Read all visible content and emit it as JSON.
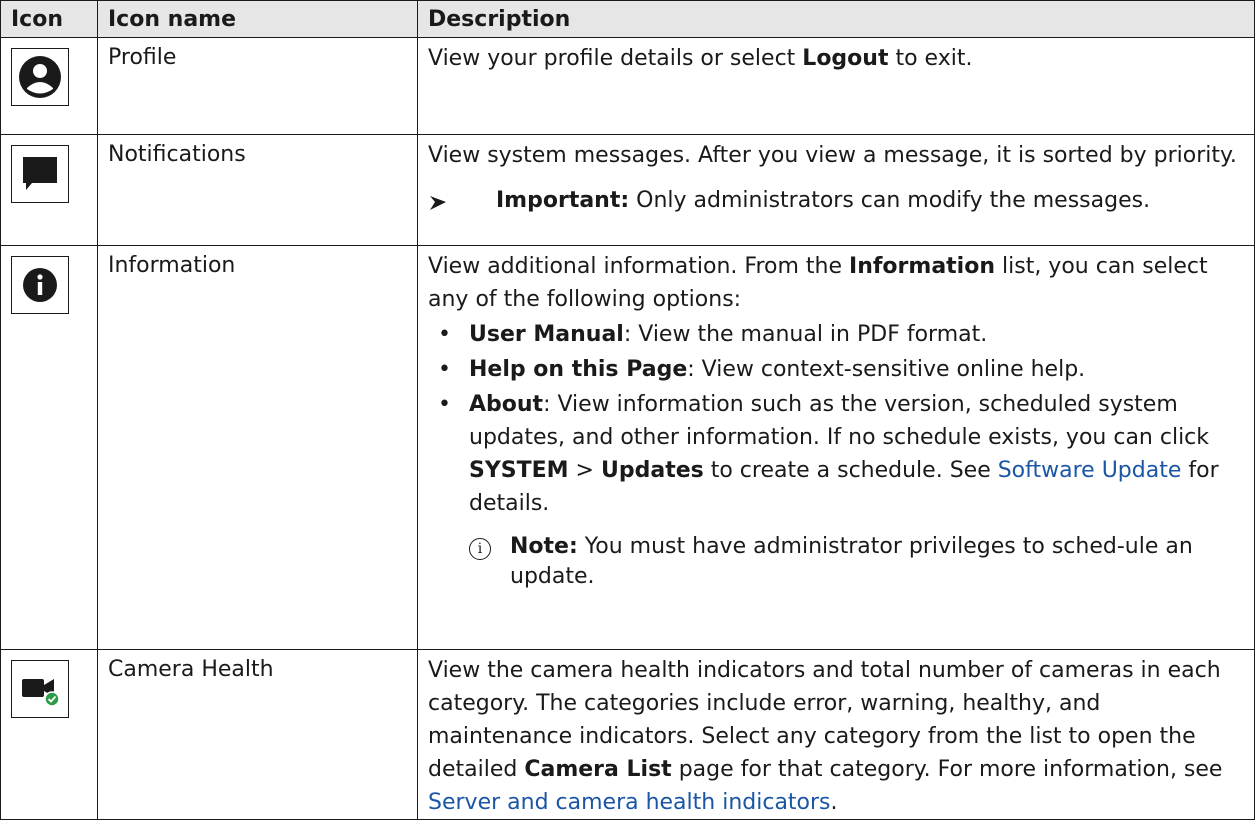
{
  "table": {
    "headers": [
      "Icon",
      "Icon name",
      "Description"
    ],
    "rows": [
      {
        "icon": "profile-icon",
        "name": "Profile",
        "desc": {
          "pre": "View your profile details or select ",
          "bold": "Logout",
          "post": " to exit."
        }
      },
      {
        "icon": "chat-icon",
        "name": "Notifications",
        "desc": "View system messages. After you view a message, it is sorted by priority.",
        "important": {
          "label": "Important:",
          "text": " Only administrators can modify the messages."
        }
      },
      {
        "icon": "info-icon",
        "name": "Information",
        "desc": {
          "pre": "View additional information. From the ",
          "bold": "Information",
          "post": " list, you can select any of the following options:"
        },
        "bullets": [
          {
            "bold": "User Manual",
            "text": ": View the manual in PDF format."
          },
          {
            "bold": "Help on this Page",
            "text": ": View context-sensitive online help."
          },
          {
            "bold": "About",
            "text": ": View information such as the version, scheduled system updates, and other information. If no schedule exists, you can click ",
            "bold2": "SYSTEM",
            "sep": " >  ",
            "bold3": "Updates",
            "text2": " to create a schedule. See ",
            "link": "Software Update",
            "text3": " for details."
          }
        ],
        "note": {
          "label": "Note:",
          "text": " You must have administrator privileges to sched-ule an update."
        }
      },
      {
        "icon": "camera-health-icon",
        "name": "Camera Health",
        "desc": {
          "pre": "View the camera health indicators and total number of cameras in each category. The categories include error, warning, healthy, and maintenance indicators. Select any category from the list to open the detailed ",
          "bold": "Camera List",
          "post": " page for that category. For more information, see ",
          "link": "Server and camera health indicators",
          "end": "."
        }
      }
    ]
  },
  "colors": {
    "border": "#1a1a1a",
    "header_bg": "#e6e6e6",
    "link": "#1b56a6",
    "health_ok": "#2e9b48"
  }
}
